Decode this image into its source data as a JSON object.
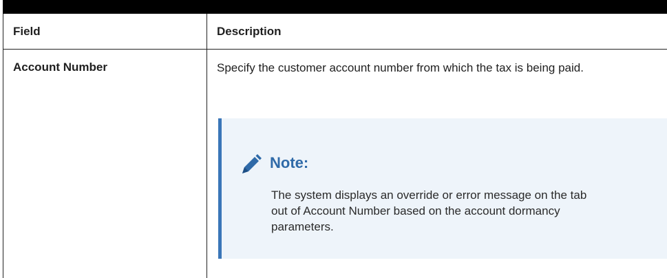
{
  "table": {
    "headers": {
      "field": "Field",
      "description": "Description"
    },
    "rows": [
      {
        "field": "Account Number",
        "description": "Specify the customer account number from which the tax is being paid.",
        "note": {
          "title": "Note:",
          "icon": "pencil-icon",
          "text": "The system displays an override or error message on the tab out of Account Number based on the account dormancy parameters."
        }
      }
    ]
  },
  "colors": {
    "rule": "#000000",
    "note_background": "#eef4fa",
    "note_accent": "#3a76b8",
    "note_title": "#2f6aa8"
  }
}
